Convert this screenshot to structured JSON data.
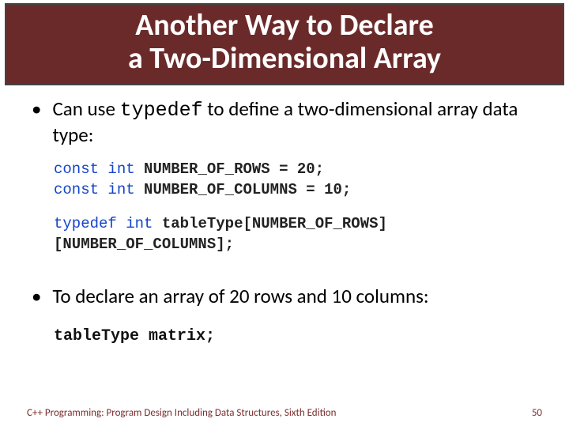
{
  "title": {
    "line1": "Another Way to Declare",
    "line2": "a Two-Dimensional Array"
  },
  "bullets": {
    "b1_pre": "Can use ",
    "b1_code": "typedef",
    "b1_post": " to define a two-dimensional array data type:",
    "b2": "To declare an array of 20 rows and 10 columns:"
  },
  "code1": {
    "kw_const1": "const",
    "kw_int1": "int",
    "rows": "NUMBER_OF_ROWS = 20;",
    "kw_const2": "const",
    "kw_int2": "int",
    "cols": "NUMBER_OF_COLUMNS = 10;",
    "kw_typedef": "typedef",
    "kw_int3": "int",
    "typedef_rest": "tableType[NUMBER_OF_ROWS][NUMBER_OF_COLUMNS];"
  },
  "code2": {
    "text": "tableType matrix;"
  },
  "footer": {
    "source": "C++ Programming: Program Design Including Data Structures, Sixth Edition",
    "page": "50"
  }
}
